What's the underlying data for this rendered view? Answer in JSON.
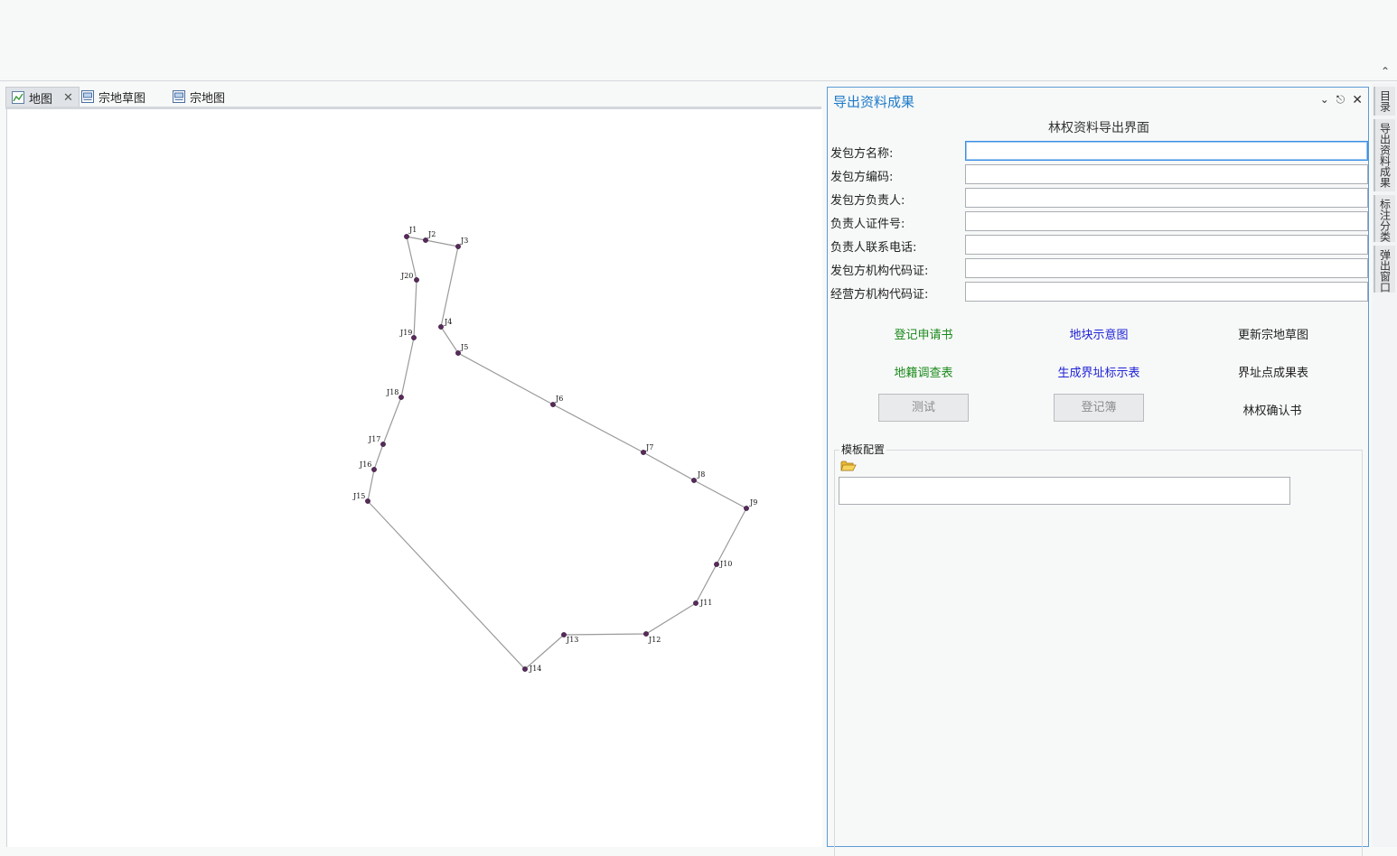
{
  "tabs": [
    {
      "label": "地图",
      "icon": "map-icon",
      "active": true,
      "closable": true
    },
    {
      "label": "宗地草图",
      "icon": "layout-icon",
      "active": false
    },
    {
      "label": "宗地图",
      "icon": "layout-icon",
      "active": false
    }
  ],
  "map": {
    "points": [
      {
        "id": "J1",
        "label": "J1"
      },
      {
        "id": "J2",
        "label": "J2"
      },
      {
        "id": "J3",
        "label": "J3"
      },
      {
        "id": "J4",
        "label": "J4"
      },
      {
        "id": "J5",
        "label": "J5"
      },
      {
        "id": "J6",
        "label": "J6"
      },
      {
        "id": "J7",
        "label": "J7"
      },
      {
        "id": "J8",
        "label": "J8"
      },
      {
        "id": "J9",
        "label": "J9"
      },
      {
        "id": "J10",
        "label": "J10"
      },
      {
        "id": "J11",
        "label": "J11"
      },
      {
        "id": "J12",
        "label": "J12"
      },
      {
        "id": "J13",
        "label": "J13"
      },
      {
        "id": "J14",
        "label": "J14"
      },
      {
        "id": "J15",
        "label": "J15"
      },
      {
        "id": "J16",
        "label": "J16"
      },
      {
        "id": "J17",
        "label": "J17"
      },
      {
        "id": "J18",
        "label": "J18"
      },
      {
        "id": "J19",
        "label": "J19"
      },
      {
        "id": "J20",
        "label": "J20"
      }
    ],
    "line_color": "#9a9a9a",
    "point_color": "#5a2a5c"
  },
  "panel": {
    "title": "导出资料成果",
    "heading": "林权资料导出界面",
    "fields": [
      {
        "label": "发包方名称:",
        "value": ""
      },
      {
        "label": "发包方编码:",
        "value": ""
      },
      {
        "label": "发包方负责人:",
        "value": ""
      },
      {
        "label": "负责人证件号:",
        "value": ""
      },
      {
        "label": "负责人联系电话:",
        "value": ""
      },
      {
        "label": "发包方机构代码证:",
        "value": ""
      },
      {
        "label": "经营方机构代码证:",
        "value": ""
      }
    ],
    "actions": {
      "register_application": "登记申请书",
      "plot_sketch": "地块示意图",
      "update_parcel_sketch": "更新宗地草图",
      "cadastral_survey": "地籍调查表",
      "boundary_marker_table": "生成界址标示表",
      "boundary_point_results": "界址点成果表",
      "test": "测试",
      "register_book": "登记簿",
      "forest_right_confirmation": "林权确认书"
    },
    "template_config": {
      "legend": "模板配置",
      "path": ""
    }
  },
  "side_tabs": [
    "目录",
    "导出资料成果",
    "标注分类",
    "弹出窗口"
  ],
  "colors": {
    "accent": "#1e7bc9",
    "green_link": "#1a8a1a",
    "blue_link": "#1e22d6"
  }
}
